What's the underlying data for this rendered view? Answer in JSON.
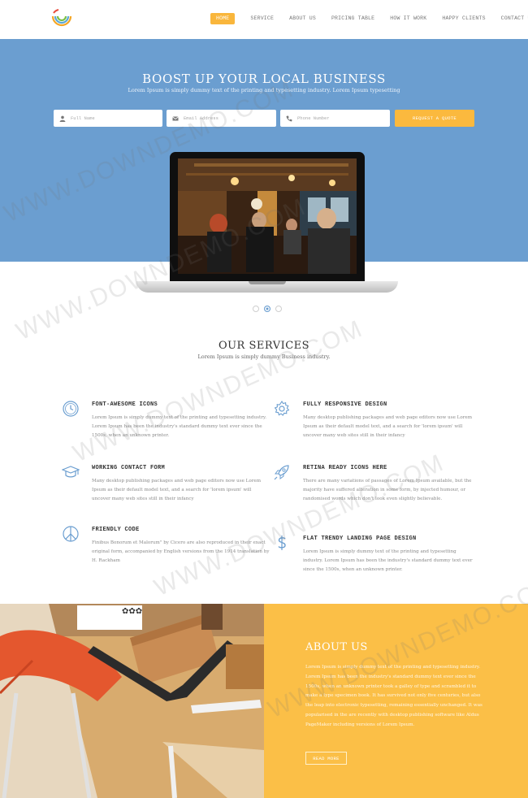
{
  "colors": {
    "accent": "#f9b63c",
    "hero_bg": "#6b9ed0",
    "about_bg": "#fbbf47"
  },
  "header": {
    "logo_icon": "rainbow-arc-logo",
    "nav": [
      "HOME",
      "SERVICE",
      "ABOUT US",
      "PRICING TABLE",
      "HOW IT WORK",
      "HAPPY CLIENTS",
      "CONTACT US"
    ],
    "active_index": 0
  },
  "hero": {
    "title": "BOOST UP YOUR LOCAL BUSINESS",
    "subtitle": "Lorem Ipsum is simply dummy text of the printing and typesetting industry. Lorem Ipsum typesetting",
    "fields": [
      {
        "icon": "user-icon",
        "placeholder": "Full Name"
      },
      {
        "icon": "envelope-icon",
        "placeholder": "Email Address"
      },
      {
        "icon": "phone-icon",
        "placeholder": "Phone Number"
      }
    ],
    "button": "REQUEST A QUOTE"
  },
  "slider": {
    "dots": 3,
    "active": 1
  },
  "services": {
    "title": "OUR SERVICES",
    "subtitle": "Lorem Ipsum is simply dummy Business industry.",
    "items": [
      {
        "icon": "clock-icon",
        "title": "FONT-AWESOME ICONS",
        "text": "Lorem Ipsum is simply dummy text of the printing and typesetting industry. Lorem Ipsum has been the industry's standard dummy text ever since the 1500s, when an unknown printer."
      },
      {
        "icon": "gear-icon",
        "title": "FULLY RESPONSIVE DESIGN",
        "text": "Many desktop publishing packages and web page editors now use Lorem Ipsum as their default model text, and a search for 'lorem ipsum' will uncover many web sites still in their infancy"
      },
      {
        "icon": "graduation-cap-icon",
        "title": "WORKING CONTACT FORM",
        "text": "Many desktop publishing packages and web page editors now use Lorem Ipsum as their default model text, and a search for 'lorem ipsum' will uncover many web sites still in their infancy"
      },
      {
        "icon": "rocket-icon",
        "title": "RETINA READY ICONS HERE",
        "text": "There are many variations of passages of Lorem Ipsum available, but the majority have suffered alteration in some form, by injected humour, or randomised words which don't look even slightly believable."
      },
      {
        "icon": "peace-icon",
        "title": "FRIENDLY CODE",
        "text": "Finibus Bonorum et Malorum\" by Cicero are also reproduced in their exact original form, accompanied by English versions from the 1914 translation by H. Rackham"
      },
      {
        "icon": "dollar-icon",
        "title": "FLAT TRENDY LANDING PAGE DESIGN",
        "text": "Lorem Ipsum is simply dummy text of the printing and typesetting industry. Lorem Ipsum has been the industry's standard dummy text ever since the 1500s, when an unknown printer."
      }
    ]
  },
  "about": {
    "title": "ABOUT US",
    "text": "Lorem Ipsum is simply dummy text of the printing and typesetting industry. Lorem Ipsum has been the industry's standard dummy text ever since the 1500s, when an unknown printer took a galley of type and scrambled it to make a type specimen book. It has survived not only five centuries, but also the leap into electronic typesetting, remaining essentially unchanged. It was popularised in the are recently with desktop publishing software like Aldus PageMaker including versions of Lorem Ipsum.",
    "button": "READ MORE"
  },
  "watermark": "WWW.DOWNDEMO.COM"
}
